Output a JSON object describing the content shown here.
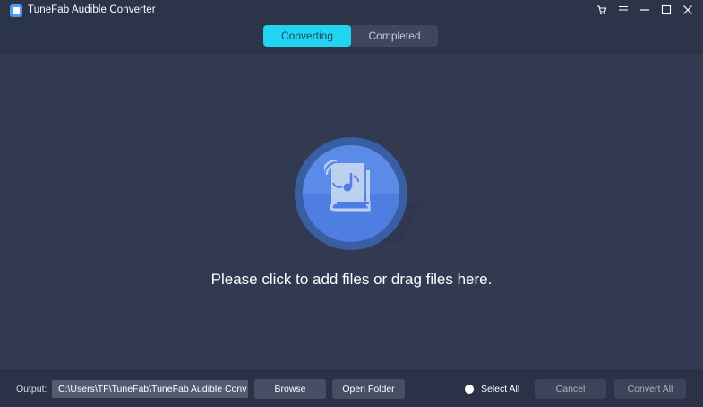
{
  "app": {
    "title": "TuneFab Audible Converter",
    "logo_icon": "app-logo-icon"
  },
  "window_controls": [
    {
      "name": "cart-icon"
    },
    {
      "name": "menu-icon"
    },
    {
      "name": "minimize-icon"
    },
    {
      "name": "maximize-icon"
    },
    {
      "name": "close-icon"
    }
  ],
  "tabs": {
    "active": "Converting",
    "inactive": "Completed"
  },
  "main": {
    "hint": "Please click to add files or drag files here.",
    "add_icon": "audiobook-add-icon"
  },
  "footer": {
    "output_label": "Output:",
    "output_path": "C:\\Users\\TF\\TuneFab\\TuneFab Audible Conv",
    "browse_label": "Browse",
    "open_folder_label": "Open Folder",
    "select_all_label": "Select All",
    "cancel_label": "Cancel",
    "convert_all_label": "Convert All"
  },
  "colors": {
    "background": "#323a52",
    "titlebar": "#2c3449",
    "accent": "#21d4f0",
    "button": "#464e64",
    "footer": "#2b3247"
  }
}
